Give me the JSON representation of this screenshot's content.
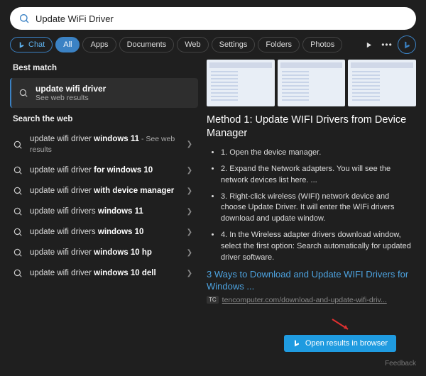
{
  "search": {
    "query": "Update WiFi Driver"
  },
  "tabs": {
    "chat": "Chat",
    "all": "All",
    "apps": "Apps",
    "documents": "Documents",
    "web": "Web",
    "settings": "Settings",
    "folders": "Folders",
    "photos": "Photos"
  },
  "sections": {
    "best_match": "Best match",
    "search_web": "Search the web"
  },
  "best_match": {
    "title": "update wifi driver",
    "subtitle": "See web results"
  },
  "suggestions": [
    {
      "prefix": "update wifi driver ",
      "bold": "windows 11",
      "suffix": " - See web results"
    },
    {
      "prefix": "update wifi driver ",
      "bold": "for windows 10",
      "suffix": ""
    },
    {
      "prefix": "update wifi driver ",
      "bold": "with device manager",
      "suffix": ""
    },
    {
      "prefix": "update wifi drivers ",
      "bold": "windows 11",
      "suffix": ""
    },
    {
      "prefix": "update wifi drivers ",
      "bold": "windows 10",
      "suffix": ""
    },
    {
      "prefix": "update wifi driver ",
      "bold": "windows 10 hp",
      "suffix": ""
    },
    {
      "prefix": "update wifi driver ",
      "bold": "windows 10 dell",
      "suffix": ""
    }
  ],
  "article": {
    "title": "Method 1: Update WIFI Drivers from Device Manager",
    "steps": [
      "1. Open the device manager.",
      "2. Expand the Network adapters. You will see the network devices list here. ...",
      "3. Right-click wireless (WIFI) network device and choose Update Driver. It will enter the WIFi drivers download and update window.",
      "4. In the Wireless adapter drivers download window, select the first option: Search automatically for updated driver software."
    ],
    "link": "3 Ways to Download and Update WIFI Drivers for Windows ...",
    "source_badge": "TC",
    "source_url": "tencomputer.com/download-and-update-wifi-driv..."
  },
  "open_button": "Open results in browser",
  "feedback": "Feedback"
}
